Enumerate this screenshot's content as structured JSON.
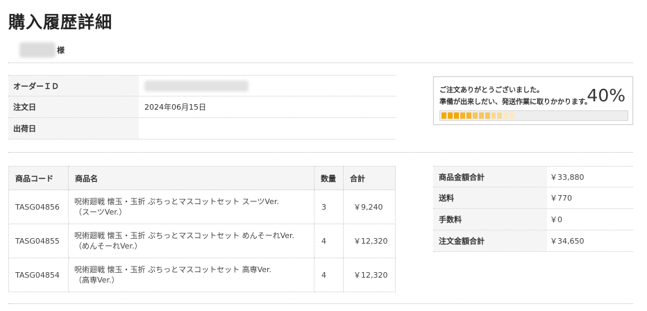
{
  "page": {
    "title": "購入履歴詳細"
  },
  "customer": {
    "honorific": "様"
  },
  "order": [
    {
      "label": "オーダーＩＤ",
      "value": ""
    },
    {
      "label": "注文日",
      "value": "2024年06月15日"
    },
    {
      "label": "出荷日",
      "value": ""
    }
  ],
  "progress": {
    "message_line1": "ご注文ありがとうございました。",
    "message_line2": "準備が出来しだい、発送作業に取りかかります。",
    "percent": 40,
    "percent_label": "40%",
    "colors": [
      "#f5a800",
      "#f7b42a",
      "#f9c55a",
      "#fbd98e",
      "#fde9bd"
    ]
  },
  "items": {
    "headers": [
      "商品コード",
      "商品名",
      "数量",
      "合計"
    ],
    "rows": [
      {
        "code": "TASG04856",
        "name_line1": "呪術廻戦 懐玉・玉折 ぷちっとマスコットセット スーツVer.",
        "name_line2": "（スーツVer.）",
        "qty": "3",
        "subtotal": "￥9,240"
      },
      {
        "code": "TASG04855",
        "name_line1": "呪術廻戦 懐玉・玉折 ぷちっとマスコットセット めんそーれVer.",
        "name_line2": "（めんそーれVer.）",
        "qty": "4",
        "subtotal": "￥12,320"
      },
      {
        "code": "TASG04854",
        "name_line1": "呪術廻戦 懐玉・玉折 ぷちっとマスコットセット 高専Ver.",
        "name_line2": "（高専Ver.）",
        "qty": "4",
        "subtotal": "￥12,320"
      }
    ]
  },
  "totals": [
    {
      "label": "商品金額合計",
      "value": "￥33,880"
    },
    {
      "label": "送料",
      "value": "￥770"
    },
    {
      "label": "手数料",
      "value": "￥0"
    },
    {
      "label": "注文金額合計",
      "value": "￥34,650"
    }
  ]
}
